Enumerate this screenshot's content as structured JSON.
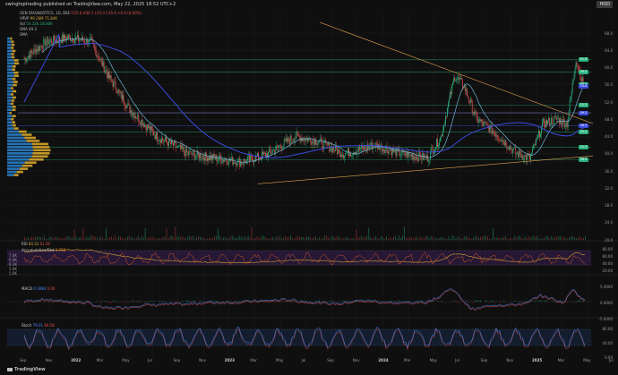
{
  "header": {
    "publisher": "swingtoptrading published on TradingView.com, May 22, 2025 18:52 UTC+2",
    "symbol_badge": "HOD"
  },
  "legend": {
    "line1_prefix": "GEN DIAGNOSTICS, 1D, BSE  ",
    "line1_values": "O35.6 H36.1 L35.0 C35.6 +0.0 (0.00%)",
    "line2_label": "VRVP",
    "line2_values": "99.26M   71.84K",
    "line3_label": "Vol",
    "line3_values": "54.32K   18.00K",
    "line4": "SMA 49.3",
    "line5": "SMA"
  },
  "colors": {
    "bg": "#0f0f0f",
    "up": "#28b07c",
    "down": "#e05050",
    "sma_fast": "#6fb6d8",
    "sma_slow": "#3b4bdc",
    "trendline": "#e0a050",
    "vp_blue": "#2a7dc7",
    "vp_gold": "#d6a52b"
  },
  "price_axis": {
    "ticks": [
      "68.0",
      "64.0",
      "60.0",
      "56.0",
      "52.0",
      "48.0",
      "44.0",
      "40.0",
      "36.0",
      "32.0",
      "28.0",
      "24.0",
      "20.0"
    ],
    "badges": [
      {
        "text": "61.8",
        "color": "#28b07c"
      },
      {
        "text": "59.0",
        "color": "#28b07c"
      },
      {
        "text": "56.0",
        "color": "#28b07c"
      },
      {
        "text": "55.6",
        "color": "#3b4bdc"
      },
      {
        "text": "51.3",
        "color": "#28b07c"
      },
      {
        "text": "49.5",
        "color": "#3b4bdc"
      },
      {
        "text": "46.5",
        "color": "#3b4bdc"
      },
      {
        "text": "45.0",
        "color": "#28b07c"
      },
      {
        "text": "41.5",
        "color": "#28b07c"
      },
      {
        "text": "38.6",
        "color": "#28b07c"
      }
    ]
  },
  "rsi": {
    "label": "RSI",
    "value": "64.31",
    "value2": "61.26",
    "extra": "Accumulation/Dist",
    "extra_value": "3.76K",
    "left_ticks": [
      "7.6K",
      "6.9K",
      "6.2K",
      "5.6K",
      "5.0K"
    ],
    "right_ticks": [
      "80.00",
      "60.00",
      "40.00",
      "20.00"
    ]
  },
  "macd": {
    "label": "MACD",
    "value": "0.3084",
    "value2": "0.00",
    "right_ticks": [
      "5.0000",
      "0.0000",
      "-5.0000"
    ]
  },
  "stoch": {
    "label": "Stoch",
    "value": "79.01",
    "value2": "84.58",
    "right_ticks": [
      "80.00",
      "40.00",
      "0.00"
    ]
  },
  "x_axis": {
    "labels": [
      {
        "t": "Sep",
        "b": false
      },
      {
        "t": "Nov",
        "b": false
      },
      {
        "t": "2022",
        "b": true
      },
      {
        "t": "Mar",
        "b": false
      },
      {
        "t": "May",
        "b": false
      },
      {
        "t": "Jul",
        "b": false
      },
      {
        "t": "Sep",
        "b": false
      },
      {
        "t": "Nov",
        "b": false
      },
      {
        "t": "2023",
        "b": true
      },
      {
        "t": "Mar",
        "b": false
      },
      {
        "t": "May",
        "b": false
      },
      {
        "t": "Jul",
        "b": false
      },
      {
        "t": "Sep",
        "b": false
      },
      {
        "t": "Nov",
        "b": false
      },
      {
        "t": "2024",
        "b": true
      },
      {
        "t": "Mar",
        "b": false
      },
      {
        "t": "May",
        "b": false
      },
      {
        "t": "Jul",
        "b": false
      },
      {
        "t": "Sep",
        "b": false
      },
      {
        "t": "Nov",
        "b": false
      },
      {
        "t": "2025",
        "b": true
      },
      {
        "t": "Mar",
        "b": false
      },
      {
        "t": "May",
        "b": false
      },
      {
        "t": "Jul",
        "b": false
      }
    ]
  },
  "brand": "TradingView"
}
